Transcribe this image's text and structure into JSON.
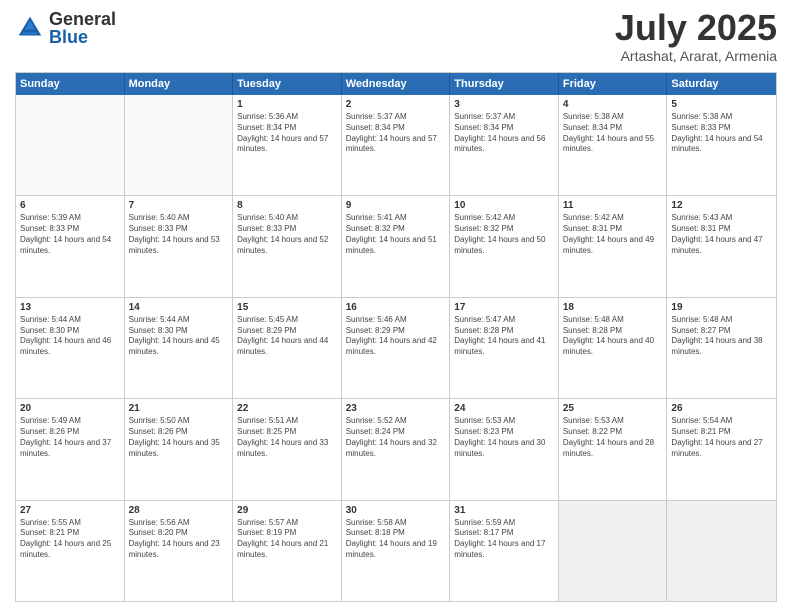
{
  "logo": {
    "general": "General",
    "blue": "Blue"
  },
  "header": {
    "month": "July 2025",
    "location": "Artashat, Ararat, Armenia"
  },
  "days": [
    "Sunday",
    "Monday",
    "Tuesday",
    "Wednesday",
    "Thursday",
    "Friday",
    "Saturday"
  ],
  "weeks": [
    [
      {
        "day": "",
        "info": ""
      },
      {
        "day": "",
        "info": ""
      },
      {
        "day": "1",
        "info": "Sunrise: 5:36 AM\nSunset: 8:34 PM\nDaylight: 14 hours and 57 minutes."
      },
      {
        "day": "2",
        "info": "Sunrise: 5:37 AM\nSunset: 8:34 PM\nDaylight: 14 hours and 57 minutes."
      },
      {
        "day": "3",
        "info": "Sunrise: 5:37 AM\nSunset: 8:34 PM\nDaylight: 14 hours and 56 minutes."
      },
      {
        "day": "4",
        "info": "Sunrise: 5:38 AM\nSunset: 8:34 PM\nDaylight: 14 hours and 55 minutes."
      },
      {
        "day": "5",
        "info": "Sunrise: 5:38 AM\nSunset: 8:33 PM\nDaylight: 14 hours and 54 minutes."
      }
    ],
    [
      {
        "day": "6",
        "info": "Sunrise: 5:39 AM\nSunset: 8:33 PM\nDaylight: 14 hours and 54 minutes."
      },
      {
        "day": "7",
        "info": "Sunrise: 5:40 AM\nSunset: 8:33 PM\nDaylight: 14 hours and 53 minutes."
      },
      {
        "day": "8",
        "info": "Sunrise: 5:40 AM\nSunset: 8:33 PM\nDaylight: 14 hours and 52 minutes."
      },
      {
        "day": "9",
        "info": "Sunrise: 5:41 AM\nSunset: 8:32 PM\nDaylight: 14 hours and 51 minutes."
      },
      {
        "day": "10",
        "info": "Sunrise: 5:42 AM\nSunset: 8:32 PM\nDaylight: 14 hours and 50 minutes."
      },
      {
        "day": "11",
        "info": "Sunrise: 5:42 AM\nSunset: 8:31 PM\nDaylight: 14 hours and 49 minutes."
      },
      {
        "day": "12",
        "info": "Sunrise: 5:43 AM\nSunset: 8:31 PM\nDaylight: 14 hours and 47 minutes."
      }
    ],
    [
      {
        "day": "13",
        "info": "Sunrise: 5:44 AM\nSunset: 8:30 PM\nDaylight: 14 hours and 46 minutes."
      },
      {
        "day": "14",
        "info": "Sunrise: 5:44 AM\nSunset: 8:30 PM\nDaylight: 14 hours and 45 minutes."
      },
      {
        "day": "15",
        "info": "Sunrise: 5:45 AM\nSunset: 8:29 PM\nDaylight: 14 hours and 44 minutes."
      },
      {
        "day": "16",
        "info": "Sunrise: 5:46 AM\nSunset: 8:29 PM\nDaylight: 14 hours and 42 minutes."
      },
      {
        "day": "17",
        "info": "Sunrise: 5:47 AM\nSunset: 8:28 PM\nDaylight: 14 hours and 41 minutes."
      },
      {
        "day": "18",
        "info": "Sunrise: 5:48 AM\nSunset: 8:28 PM\nDaylight: 14 hours and 40 minutes."
      },
      {
        "day": "19",
        "info": "Sunrise: 5:48 AM\nSunset: 8:27 PM\nDaylight: 14 hours and 38 minutes."
      }
    ],
    [
      {
        "day": "20",
        "info": "Sunrise: 5:49 AM\nSunset: 8:26 PM\nDaylight: 14 hours and 37 minutes."
      },
      {
        "day": "21",
        "info": "Sunrise: 5:50 AM\nSunset: 8:26 PM\nDaylight: 14 hours and 35 minutes."
      },
      {
        "day": "22",
        "info": "Sunrise: 5:51 AM\nSunset: 8:25 PM\nDaylight: 14 hours and 33 minutes."
      },
      {
        "day": "23",
        "info": "Sunrise: 5:52 AM\nSunset: 8:24 PM\nDaylight: 14 hours and 32 minutes."
      },
      {
        "day": "24",
        "info": "Sunrise: 5:53 AM\nSunset: 8:23 PM\nDaylight: 14 hours and 30 minutes."
      },
      {
        "day": "25",
        "info": "Sunrise: 5:53 AM\nSunset: 8:22 PM\nDaylight: 14 hours and 28 minutes."
      },
      {
        "day": "26",
        "info": "Sunrise: 5:54 AM\nSunset: 8:21 PM\nDaylight: 14 hours and 27 minutes."
      }
    ],
    [
      {
        "day": "27",
        "info": "Sunrise: 5:55 AM\nSunset: 8:21 PM\nDaylight: 14 hours and 25 minutes."
      },
      {
        "day": "28",
        "info": "Sunrise: 5:56 AM\nSunset: 8:20 PM\nDaylight: 14 hours and 23 minutes."
      },
      {
        "day": "29",
        "info": "Sunrise: 5:57 AM\nSunset: 8:19 PM\nDaylight: 14 hours and 21 minutes."
      },
      {
        "day": "30",
        "info": "Sunrise: 5:58 AM\nSunset: 8:18 PM\nDaylight: 14 hours and 19 minutes."
      },
      {
        "day": "31",
        "info": "Sunrise: 5:59 AM\nSunset: 8:17 PM\nDaylight: 14 hours and 17 minutes."
      },
      {
        "day": "",
        "info": ""
      },
      {
        "day": "",
        "info": ""
      }
    ]
  ]
}
